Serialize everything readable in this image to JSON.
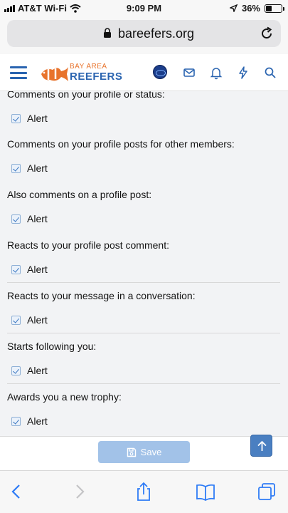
{
  "status_bar": {
    "carrier": "AT&T Wi-Fi",
    "time": "9:09 PM",
    "battery": "36%",
    "battery_level": 0.36
  },
  "browser": {
    "url": "bareefers.org"
  },
  "site": {
    "logo_line1": "BAY AREA",
    "logo_line2": "REEFERS"
  },
  "alert_groups": [
    {
      "title": "Comments on your profile or status:",
      "option": "Alert",
      "checked": true
    },
    {
      "title": "Comments on your profile posts for other members:",
      "option": "Alert",
      "checked": true
    },
    {
      "title": "Also comments on a profile post:",
      "option": "Alert",
      "checked": true
    },
    {
      "title": "Reacts to your profile post comment:",
      "option": "Alert",
      "checked": true
    },
    {
      "title": "Reacts to your message in a conversation:",
      "option": "Alert",
      "checked": true
    },
    {
      "title": "Starts following you:",
      "option": "Alert",
      "checked": true
    },
    {
      "title": "Awards you a new trophy:",
      "option": "Alert",
      "checked": true
    }
  ],
  "form": {
    "save_label": "Save"
  },
  "colors": {
    "accent": "#2a64b0",
    "brand_orange": "#e8732c",
    "save_button": "#a2c2e8"
  }
}
